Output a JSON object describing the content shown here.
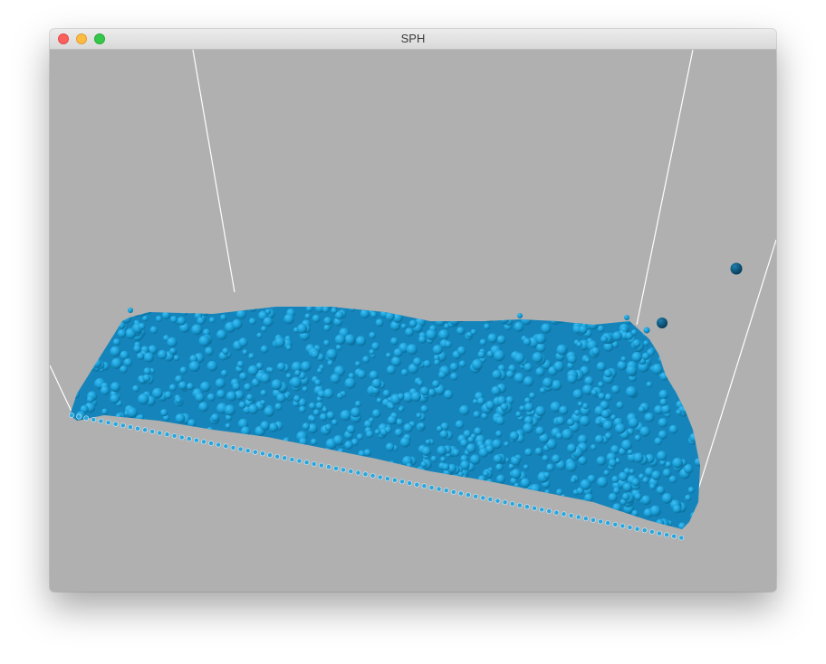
{
  "window": {
    "title": "SPH",
    "controls": {
      "close": "close-window",
      "minimize": "minimize-window",
      "zoom": "zoom-window"
    }
  },
  "scene": {
    "background_color": "#b0b0b0",
    "container_line_color": "#ffffff",
    "particle_color": "#1a9fd8",
    "particle_color_dark": "#0b6e9b",
    "stray_particle_color": "#0b4f72",
    "content": "fluid-particles"
  }
}
